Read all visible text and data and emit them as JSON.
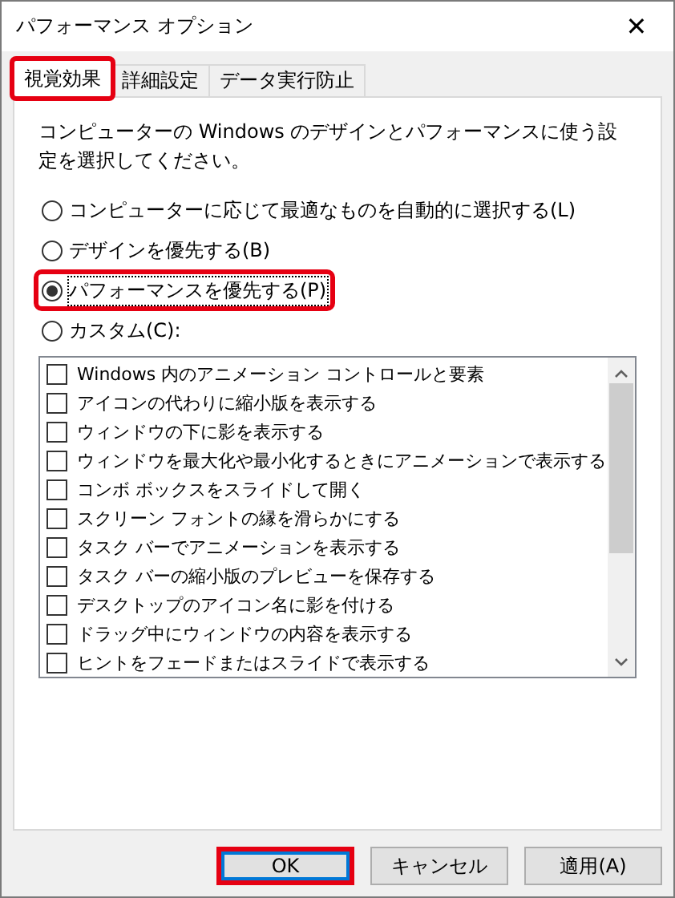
{
  "window": {
    "title": "パフォーマンス オプション",
    "close": "✕"
  },
  "tabs": [
    {
      "label": "視覚効果",
      "selected": true,
      "highlighted": true
    },
    {
      "label": "詳細設定",
      "selected": false,
      "highlighted": false
    },
    {
      "label": "データ実行防止",
      "selected": false,
      "highlighted": false
    }
  ],
  "description": "コンピューターの Windows のデザインとパフォーマンスに使う設定を選択してください。",
  "options": [
    {
      "label": "コンピューターに応じて最適なものを自動的に選択する(L)",
      "selected": false,
      "highlighted": false
    },
    {
      "label": "デザインを優先する(B)",
      "selected": false,
      "highlighted": false
    },
    {
      "label": "パフォーマンスを優先する(P)",
      "selected": true,
      "highlighted": true
    },
    {
      "label": "カスタム(C):",
      "selected": false,
      "highlighted": false
    }
  ],
  "effects": [
    {
      "label": "Windows 内のアニメーション コントロールと要素",
      "checked": false
    },
    {
      "label": "アイコンの代わりに縮小版を表示する",
      "checked": false
    },
    {
      "label": "ウィンドウの下に影を表示する",
      "checked": false
    },
    {
      "label": "ウィンドウを最大化や最小化するときにアニメーションで表示する",
      "checked": false
    },
    {
      "label": "コンボ ボックスをスライドして開く",
      "checked": false
    },
    {
      "label": "スクリーン フォントの縁を滑らかにする",
      "checked": false
    },
    {
      "label": "タスク バーでアニメーションを表示する",
      "checked": false
    },
    {
      "label": "タスク バーの縮小版のプレビューを保存する",
      "checked": false
    },
    {
      "label": "デスクトップのアイコン名に影を付ける",
      "checked": false
    },
    {
      "label": "ドラッグ中にウィンドウの内容を表示する",
      "checked": false
    },
    {
      "label": "ヒントをフェードまたはスライドで表示する",
      "checked": false
    }
  ],
  "buttons": [
    {
      "label": "OK",
      "default": true,
      "highlighted": true
    },
    {
      "label": "キャンセル",
      "default": false,
      "highlighted": false
    },
    {
      "label": "適用(A)",
      "default": false,
      "highlighted": false
    }
  ]
}
